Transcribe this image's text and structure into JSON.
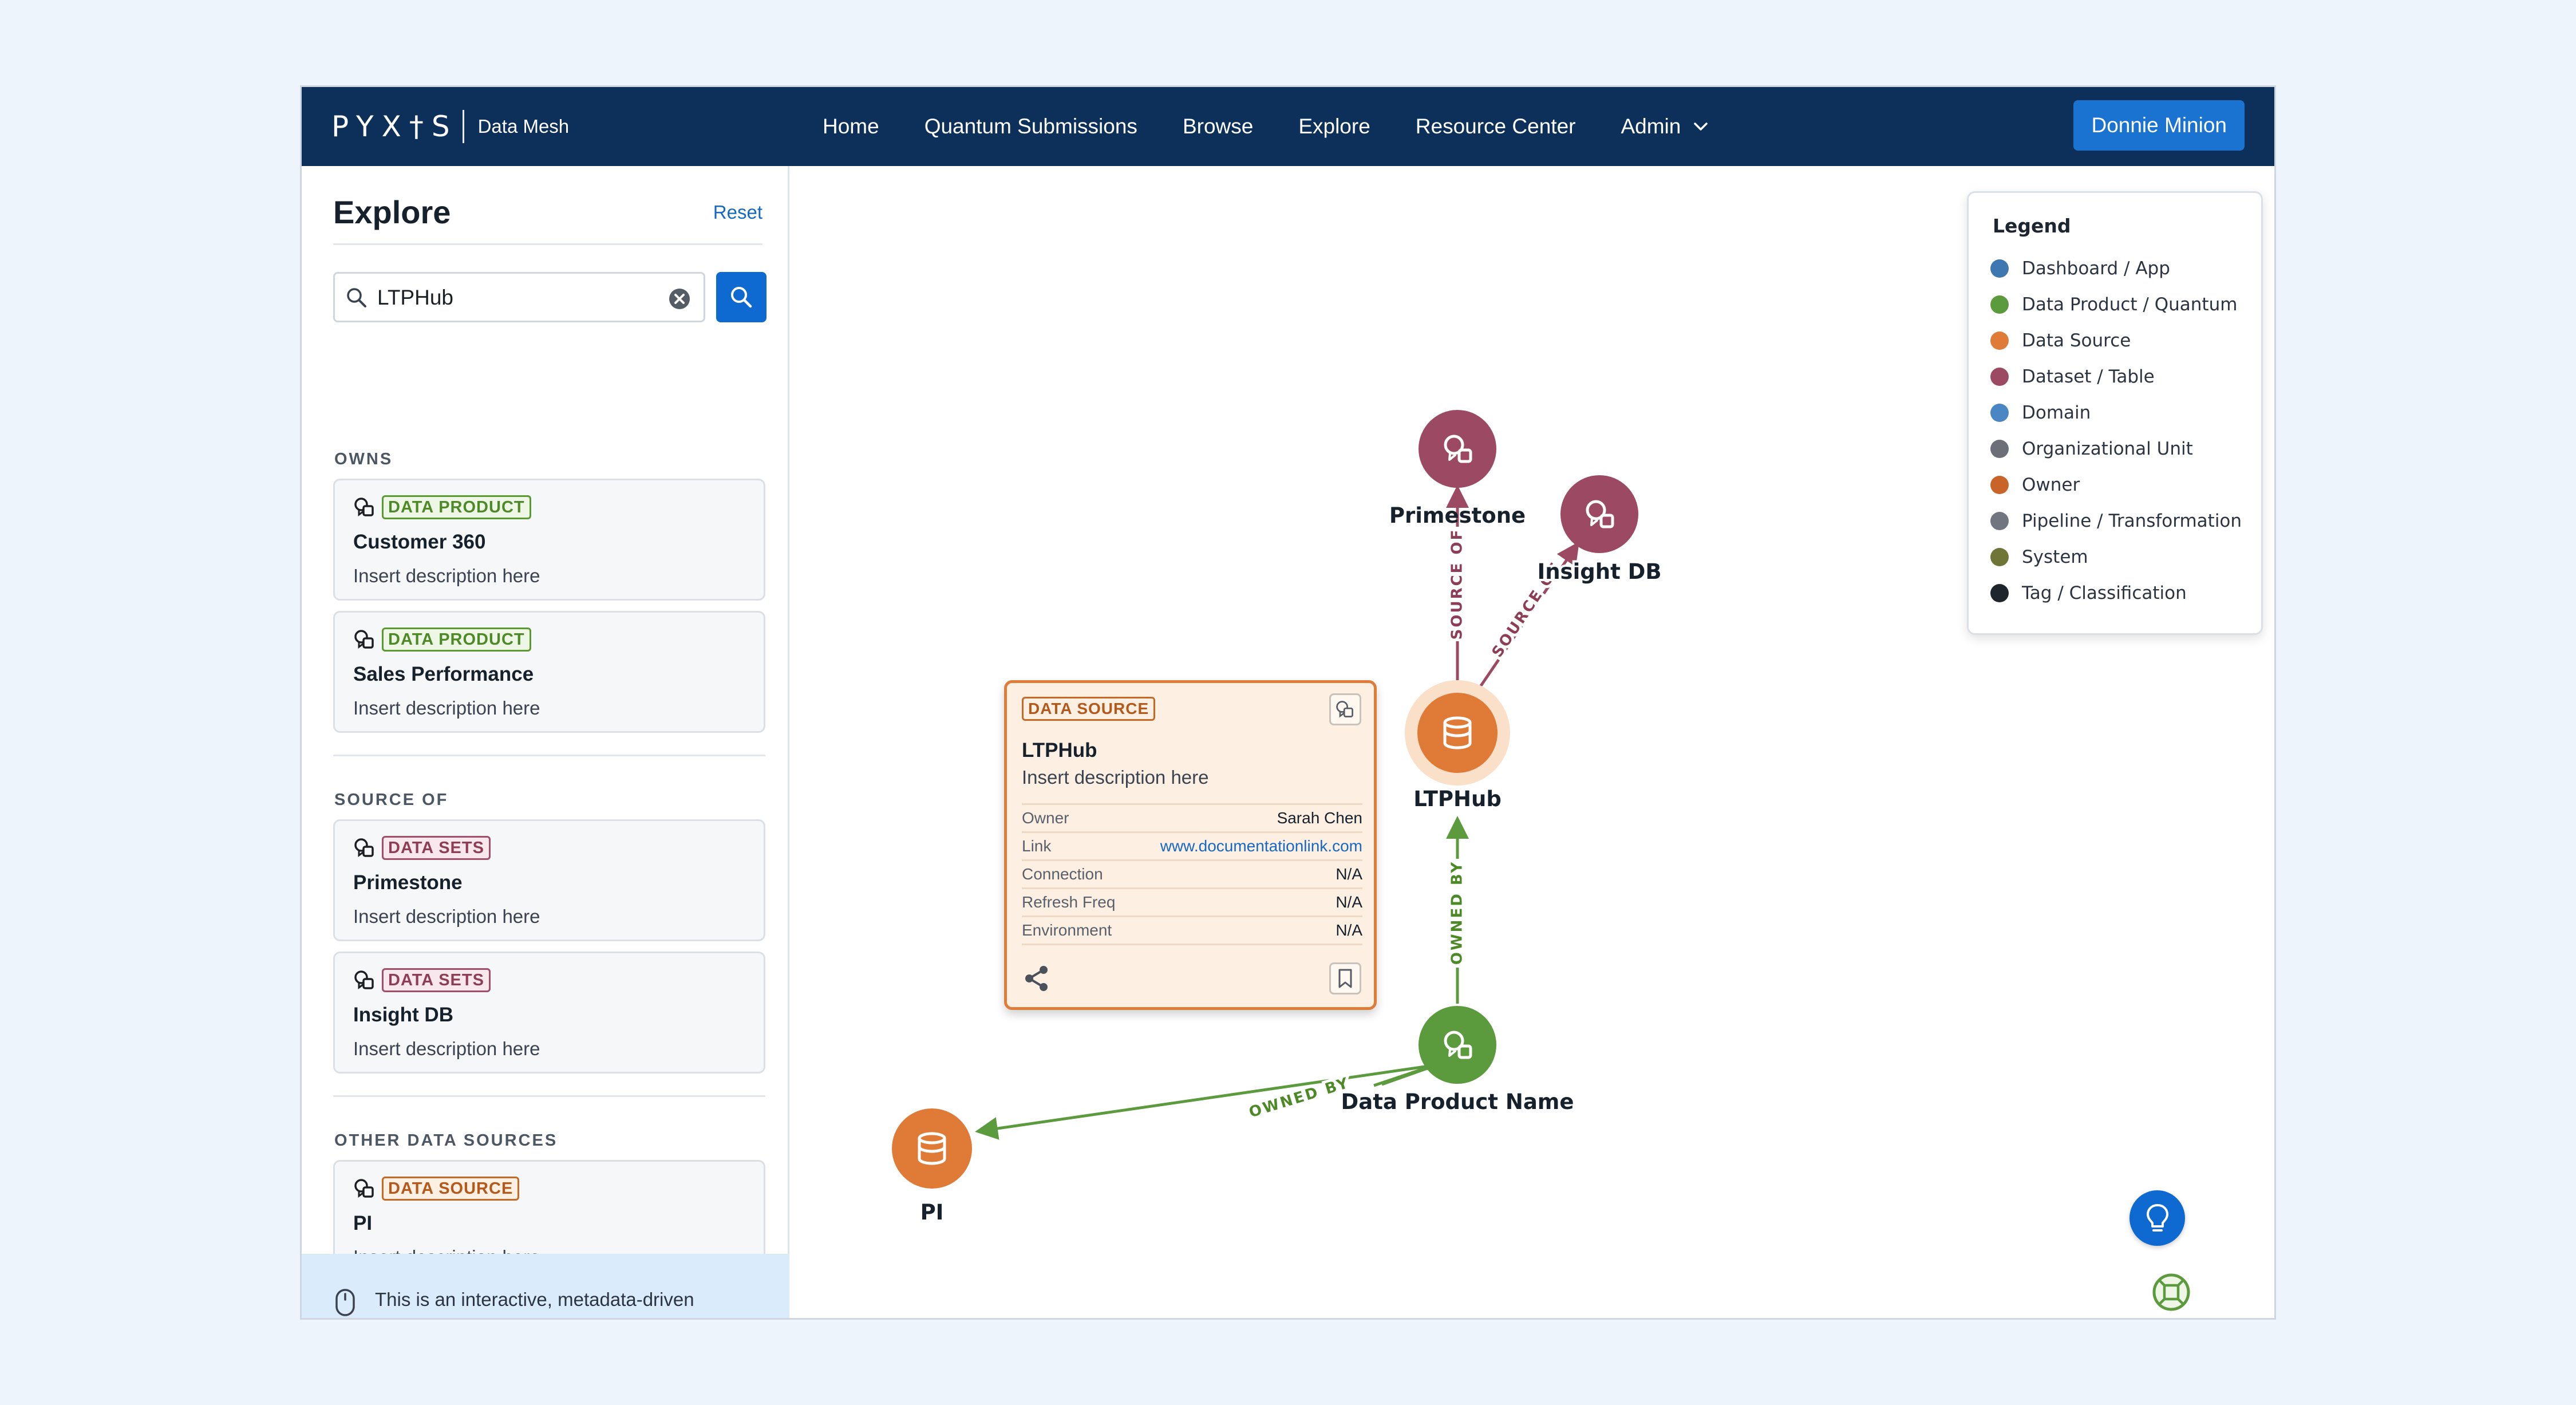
{
  "brand": {
    "name": "PYX†S",
    "product": "Data Mesh"
  },
  "nav": {
    "links": [
      "Home",
      "Quantum Submissions",
      "Browse",
      "Explore",
      "Resource Center",
      "Admin"
    ],
    "user": "Donnie Minion"
  },
  "sidebar": {
    "title": "Explore",
    "reset": "Reset",
    "search": {
      "value": "LTPHub"
    },
    "sections": [
      {
        "label": "OWNS",
        "items": [
          {
            "badge": "DATA PRODUCT",
            "title": "Customer 360",
            "desc": "Insert description here"
          },
          {
            "badge": "DATA PRODUCT",
            "title": "Sales Performance",
            "desc": "Insert description here"
          }
        ]
      },
      {
        "label": "SOURCE OF",
        "items": [
          {
            "badge": "DATA SETS",
            "title": "Primestone",
            "desc": "Insert description here"
          },
          {
            "badge": "DATA SETS",
            "title": "Insight DB",
            "desc": "Insert description here"
          }
        ]
      },
      {
        "label": "OTHER DATA SOURCES",
        "items": [
          {
            "badge": "DATA SOURCE",
            "title": "PI",
            "desc": "Insert description here"
          }
        ]
      }
    ],
    "info": "This is an interactive, metadata-driven environment displaying the data ecosystem within Dominion."
  },
  "legend": {
    "title": "Legend",
    "items": [
      {
        "label": "Dashboard / App",
        "color": "#3f78b0"
      },
      {
        "label": "Data Product / Quantum",
        "color": "#5c9a3e"
      },
      {
        "label": "Data Source",
        "color": "#e07a37"
      },
      {
        "label": "Dataset / Table",
        "color": "#9c4a63"
      },
      {
        "label": "Domain",
        "color": "#4b86c4"
      },
      {
        "label": "Organizational Unit",
        "color": "#6b7078"
      },
      {
        "label": "Owner",
        "color": "#c8642a"
      },
      {
        "label": "Pipeline / Transformation",
        "color": "#707580"
      },
      {
        "label": "System",
        "color": "#6f7536"
      },
      {
        "label": "Tag / Classification",
        "color": "#1f252d"
      }
    ]
  },
  "graph": {
    "nodes": [
      {
        "id": "primestone",
        "label": "Primestone",
        "kind": "dataset",
        "icon": "chat-icon"
      },
      {
        "id": "insightdb",
        "label": "Insight DB",
        "kind": "dataset",
        "icon": "chat-icon"
      },
      {
        "id": "ltphub",
        "label": "LTPHub",
        "kind": "data-source",
        "icon": "database-icon"
      },
      {
        "id": "dataproduct",
        "label": "Data Product Name",
        "kind": "data-product",
        "icon": "chat-icon"
      },
      {
        "id": "pi",
        "label": "PI",
        "kind": "data-source",
        "icon": "database-icon"
      }
    ],
    "edges": [
      {
        "from": "ltphub",
        "to": "primestone",
        "label": "SOURCE OF"
      },
      {
        "from": "ltphub",
        "to": "insightdb",
        "label": "SOURCE OF"
      },
      {
        "from": "dataproduct",
        "to": "ltphub",
        "label": "OWNED BY"
      },
      {
        "from": "dataproduct",
        "to": "pi",
        "label": "OWNED BY"
      }
    ],
    "colors": {
      "dataset": "#9c4a63",
      "data_source": "#e07a37",
      "data_product": "#5c9a3e"
    }
  },
  "detail": {
    "badge": "DATA SOURCE",
    "title": "LTPHub",
    "desc": "Insert description here",
    "rows": [
      {
        "key": "Owner",
        "value": "Sarah Chen"
      },
      {
        "key": "Link",
        "value": "www.documentationlink.com"
      },
      {
        "key": "Connection",
        "value": "N/A"
      },
      {
        "key": "Refresh Freq",
        "value": "N/A"
      },
      {
        "key": "Environment",
        "value": "N/A"
      }
    ]
  }
}
